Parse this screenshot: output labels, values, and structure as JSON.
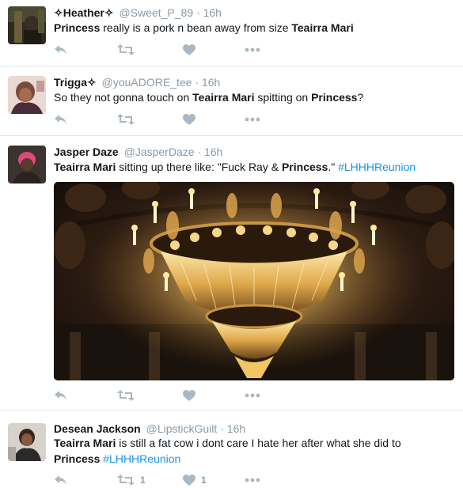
{
  "tweets": [
    {
      "name_prefix": "✧",
      "name": "Heather",
      "name_suffix": "✧",
      "handle": "@Sweet_P_89",
      "separator": "·",
      "time": "16h",
      "text_parts": [
        "Princess",
        " really is a pork n bean away from size ",
        "Teairra Mari"
      ],
      "retweet_count": "",
      "like_count": ""
    },
    {
      "name": "Trigga",
      "name_suffix": "✧",
      "handle": "@youADORE_tee",
      "separator": "·",
      "time": "16h",
      "text_parts": [
        "So they not gonna touch on ",
        "Teairra Mari",
        " spitting on ",
        "Princess",
        "?"
      ]
    },
    {
      "name": "Jasper Daze",
      "handle": "@JasperDaze",
      "separator": "·",
      "time": "16h",
      "text_parts": [
        "Teairra Mari",
        " sitting up there like: \"Fuck Ray & ",
        "Princess",
        ".\" ",
        "#LHHHReunion"
      ]
    },
    {
      "name": "Desean Jackson",
      "handle": "@LipstickGuilt",
      "separator": "·",
      "time": "16h",
      "text_line1": [
        " is still a fat cow i dont care I hate her after what she did to"
      ],
      "bold_a": "Teairra Mari",
      "bold_b": "Princess",
      "hashtag": "#LHHHReunion",
      "retweet_count": "1",
      "like_count": "1"
    }
  ],
  "icons": {
    "reply": "reply-icon",
    "retweet": "retweet-icon",
    "like": "heart-icon",
    "more": "more-icon"
  },
  "colors": {
    "icon_gray": "#aab8c2",
    "hashtag_blue": "#1b95e0",
    "border": "#e1e8ed",
    "meta_gray": "#8899a6"
  }
}
